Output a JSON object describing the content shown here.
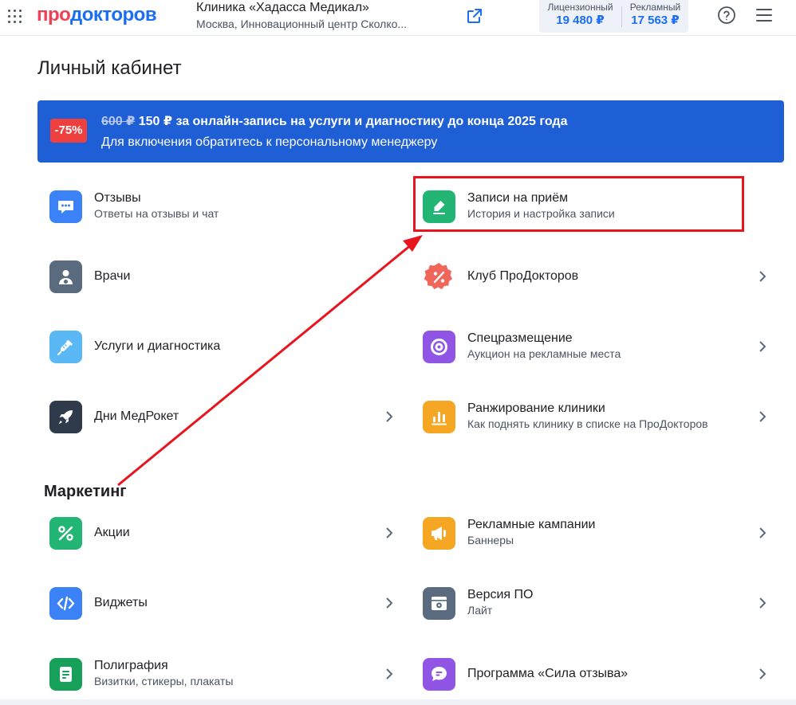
{
  "header": {
    "logo_part1": "про",
    "logo_part2": "докторов",
    "clinic_name": "Клиника «Хадасса Медикал»",
    "clinic_address": "Москва, Инновационный центр Сколко...",
    "license_label": "Лицензионный",
    "license_value": "19 480 ₽",
    "ads_label": "Рекламный",
    "ads_value": "17 563 ₽"
  },
  "page_title": "Личный кабинет",
  "banner": {
    "discount": "-75%",
    "old_price": "600 ₽",
    "headline": " 150 ₽ за онлайн-запись на услуги и диагностику до конца 2025 года",
    "subtext": "Для включения обратитесь к персональному менеджеру"
  },
  "items": {
    "reviews": {
      "title": "Отзывы",
      "subtitle": "Ответы на отзывы и чат",
      "color": "#3b82f6",
      "icon": "chat-icon"
    },
    "appointments": {
      "title": "Записи на приём",
      "subtitle": "История и настройка записи",
      "color": "#22b573",
      "icon": "edit-icon"
    },
    "doctors": {
      "title": "Врачи",
      "color": "#5a6b80",
      "icon": "doctor-icon"
    },
    "club": {
      "title": "Клуб ПроДокторов",
      "color": "#f0665a",
      "icon": "discount-badge-icon"
    },
    "services": {
      "title": "Услуги и диагностика",
      "color": "#5ab8f5",
      "icon": "syringe-icon"
    },
    "special": {
      "title": "Спецразмещение",
      "subtitle": "Аукцион на рекламные места",
      "color": "#9155e6",
      "icon": "target-icon"
    },
    "medrocket": {
      "title": "Дни МедРокет",
      "color": "#2f3a4a",
      "icon": "rocket-icon"
    },
    "ranking": {
      "title": "Ранжирование клиники",
      "subtitle": "Как поднять клинику в списке на ПроДокторов",
      "color": "#f5a623",
      "icon": "bar-chart-icon"
    },
    "promos": {
      "title": "Акции",
      "color": "#22b573",
      "icon": "percent-icon"
    },
    "campaigns": {
      "title": "Рекламные кампании",
      "subtitle": "Баннеры",
      "color": "#f5a623",
      "icon": "megaphone-icon"
    },
    "widgets": {
      "title": "Виджеты",
      "color": "#3b82f6",
      "icon": "code-icon"
    },
    "version": {
      "title": "Версия ПО",
      "subtitle": "Лайт",
      "color": "#5a6b80",
      "icon": "settings-window-icon"
    },
    "print": {
      "title": "Полиграфия",
      "subtitle": "Визитки, стикеры, плакаты",
      "color": "#16a05a",
      "icon": "document-icon"
    },
    "feedback_power": {
      "title": "Программа «Сила отзыва»",
      "color": "#9155e6",
      "icon": "speech-bubble-icon"
    }
  },
  "marketing_title": "Маркетинг",
  "colors": {
    "brand_red": "#ef4056",
    "brand_blue": "#1b6ef3",
    "banner_bg": "#1f5fd6",
    "annotation": "#e8141e"
  }
}
